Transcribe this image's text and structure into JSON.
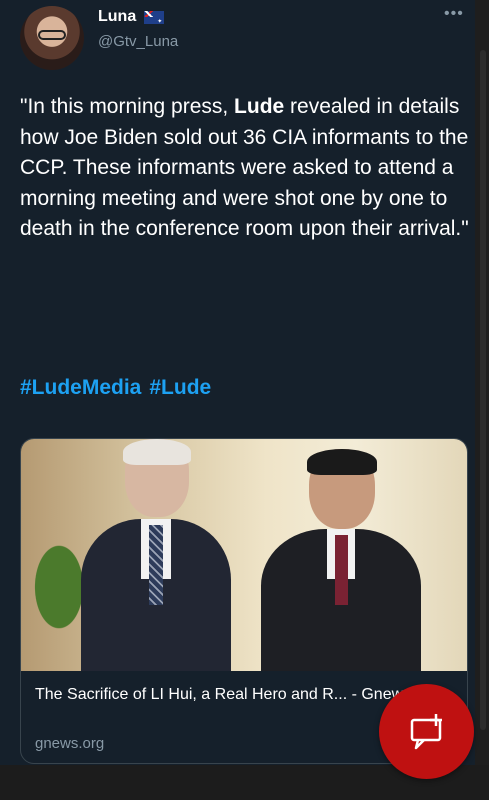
{
  "tweet": {
    "author_name": "Luna",
    "handle": "@Gtv_Luna",
    "more_icon": "more-horizontal-icon",
    "text_part1": "\"In this morning press, ",
    "text_bold": "Lude",
    "text_part2": " revealed in details how Joe Biden sold out 36 CIA informants to the CCP. These informants were asked to attend a morning meeting and were shot one by one to death in the conference room upon their arrival.\"",
    "hashtags": [
      "#LudeMedia",
      "#Lude"
    ]
  },
  "card": {
    "title": "The Sacrifice of LI Hui, a Real Hero and R... - Gnews",
    "domain": "gnews.org"
  },
  "fab": {
    "icon": "share-icon"
  },
  "colors": {
    "background": "#15202b",
    "hashtag": "#1da1f2",
    "fab": "#bf1111",
    "secondary_text": "#8899a6"
  }
}
